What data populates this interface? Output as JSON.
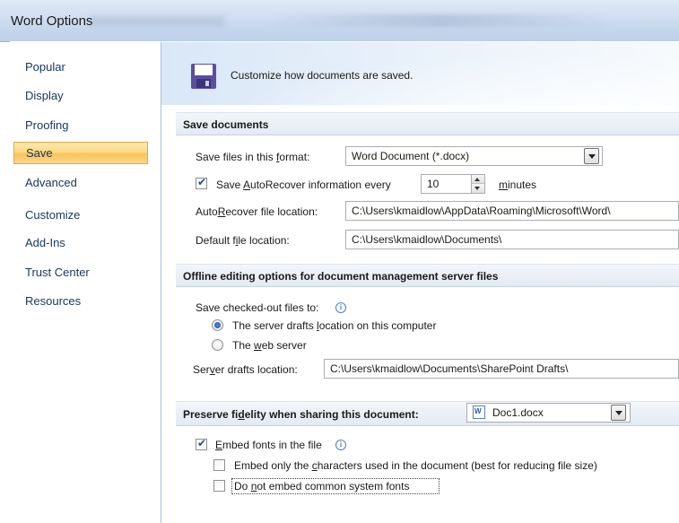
{
  "window": {
    "title": "Word Options"
  },
  "sidebar": {
    "items": [
      {
        "label": "Popular",
        "selected": false
      },
      {
        "label": "Display",
        "selected": false
      },
      {
        "label": "Proofing",
        "selected": false
      },
      {
        "label": "Save",
        "selected": true
      },
      {
        "label": "Advanced",
        "selected": false
      },
      {
        "label": "Customize",
        "selected": false
      },
      {
        "label": "Add-Ins",
        "selected": false
      },
      {
        "label": "Trust Center",
        "selected": false
      },
      {
        "label": "Resources",
        "selected": false
      }
    ]
  },
  "banner": {
    "text": "Customize how documents are saved.",
    "icon": "floppy-disk-icon"
  },
  "save_documents": {
    "header": "Save documents",
    "format_label_pre": "Save files in this ",
    "format_label_u": "f",
    "format_label_post": "ormat:",
    "format_value": "Word Document (*.docx)",
    "autorecover_pre": "Save ",
    "autorecover_u": "A",
    "autorecover_post": "utoRecover information every",
    "autorecover_checked": true,
    "autorecover_minutes": "10",
    "minutes_u": "m",
    "minutes_post": "inutes",
    "autorecover_loc_pre": "Auto",
    "autorecover_loc_u": "R",
    "autorecover_loc_post": "ecover file location:",
    "autorecover_loc_value": "C:\\Users\\kmaidlow\\AppData\\Roaming\\Microsoft\\Word\\",
    "default_loc_pre": "Default f",
    "default_loc_u": "i",
    "default_loc_post": "le location:",
    "default_loc_value": "C:\\Users\\kmaidlow\\Documents\\"
  },
  "offline": {
    "header": "Offline editing options for document management server files",
    "checked_out_label": "Save checked-out files to:",
    "radio1_pre": "The server drafts ",
    "radio1_u": "l",
    "radio1_post": "ocation on this computer",
    "radio1_selected": true,
    "radio2_pre": "The ",
    "radio2_u": "w",
    "radio2_post": "eb server",
    "radio2_selected": false,
    "drafts_loc_pre": "Ser",
    "drafts_loc_u": "v",
    "drafts_loc_post": "er drafts location:",
    "drafts_loc_value": "C:\\Users\\kmaidlow\\Documents\\SharePoint Drafts\\"
  },
  "fidelity": {
    "header_pre": "Preserve fi",
    "header_u": "d",
    "header_post": "elity when sharing this document:",
    "doc_value": "Doc1.docx",
    "embed_u": "E",
    "embed_post": "mbed fonts in the file",
    "embed_checked": true,
    "embed_only_pre": "Embed only the ",
    "embed_only_u": "c",
    "embed_only_post": "haracters used in the document (best for reducing file size)",
    "embed_only_checked": false,
    "no_common_pre": "Do ",
    "no_common_u": "n",
    "no_common_post": "ot embed common system fonts",
    "no_common_checked": false
  }
}
